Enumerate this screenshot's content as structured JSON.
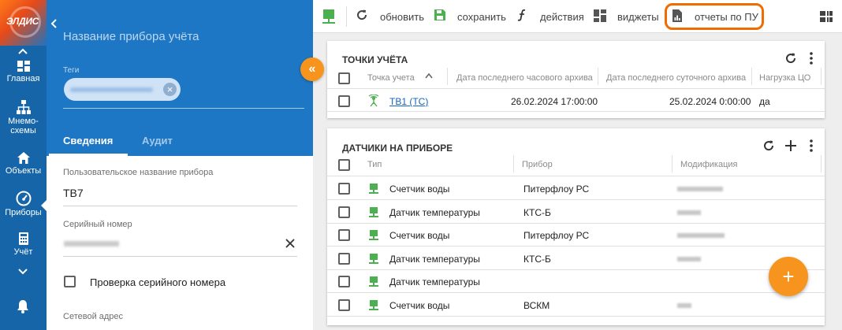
{
  "logo": {
    "text": "ЭЛДИС"
  },
  "nav": {
    "items": [
      {
        "label": "Главная",
        "icon": "dashboard-icon"
      },
      {
        "label": "Мнемо-схемы",
        "label1": "Мнемо-",
        "label2": "схемы",
        "icon": "hierarchy-icon"
      },
      {
        "label": "Объекты",
        "icon": "home-icon"
      },
      {
        "label": "Приборы",
        "icon": "gauge-icon"
      },
      {
        "label": "Учёт",
        "icon": "calculator-icon"
      }
    ]
  },
  "panel": {
    "device_name_placeholder": "Название прибора учёта",
    "tags_label": "Теги",
    "tabs": [
      "Сведения",
      "Аудит"
    ],
    "fields": {
      "user_name_label": "Пользовательское название прибора",
      "user_name_value": "ТВ7",
      "serial_label": "Серийный номер",
      "serial_check_label": "Проверка серийного номера",
      "network_label": "Сетевой адрес"
    },
    "collapse_glyph": "«"
  },
  "toolbar": {
    "refresh": "обновить",
    "save": "сохранить",
    "actions": "действия",
    "widgets": "виджеты",
    "reports": "отчеты по ПУ"
  },
  "colors": {
    "primary": "#1d77c4",
    "accent": "#f7941d",
    "highlight": "#ef6c00",
    "device_green": "#4caf50"
  },
  "points": {
    "title": "ТОЧКИ УЧЁТА",
    "columns": [
      "Точка учета",
      "Дата последнего часового архива",
      "Дата последнего суточного архива",
      "Нагрузка ЦО"
    ],
    "rows": [
      {
        "name": "ТВ1 (ТС)",
        "hourly": "26.02.2024 17:00:00",
        "daily": "25.02.2024 0:00:00",
        "load": "да"
      }
    ]
  },
  "sensors": {
    "title": "ДАТЧИКИ НА ПРИБОРЕ",
    "columns": [
      "Тип",
      "Прибор",
      "Модификация"
    ],
    "rows": [
      {
        "type": "Счетчик воды",
        "device": "Питерфлоу РС"
      },
      {
        "type": "Датчик температуры",
        "device": "КТС-Б"
      },
      {
        "type": "Счетчик воды",
        "device": "Питерфлоу РС"
      },
      {
        "type": "Датчик температуры",
        "device": "КТС-Б"
      },
      {
        "type": "Датчик температуры",
        "device": ""
      },
      {
        "type": "Счетчик воды",
        "device": "ВСКМ"
      }
    ]
  },
  "fab": {
    "glyph": "+"
  }
}
